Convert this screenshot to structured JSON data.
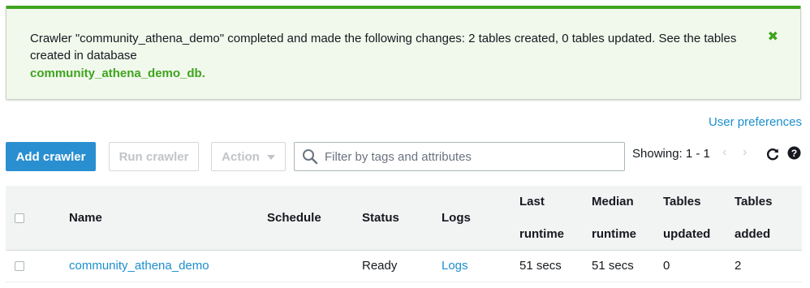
{
  "flash": {
    "message": "Crawler \"community_athena_demo\" completed and made the following changes: 2 tables created, 0 tables updated. See the tables created in database",
    "database": "community_athena_demo_db."
  },
  "user_preferences": "User preferences",
  "toolbar": {
    "add_label": "Add crawler",
    "run_label": "Run crawler",
    "action_label": "Action",
    "search_placeholder": "Filter by tags and attributes",
    "showing": "Showing: 1 - 1",
    "prev": "‹",
    "next": "›"
  },
  "table": {
    "headers": {
      "name": "Name",
      "schedule": "Schedule",
      "status": "Status",
      "logs": "Logs",
      "last_runtime_1": "Last",
      "last_runtime_2": "runtime",
      "median_runtime_1": "Median",
      "median_runtime_2": "runtime",
      "tables_updated_1": "Tables",
      "tables_updated_2": "updated",
      "tables_added_1": "Tables",
      "tables_added_2": "added"
    },
    "rows": [
      {
        "name": "community_athena_demo",
        "schedule": "",
        "status": "Ready",
        "logs": "Logs",
        "last_runtime": "51 secs",
        "median_runtime": "51 secs",
        "tables_updated": "0",
        "tables_added": "2"
      }
    ]
  },
  "colors": {
    "success": "#3ea41e",
    "primary": "#2a8fd1",
    "link": "#1a8fce"
  },
  "icons": [
    "close-icon",
    "search-icon",
    "refresh-icon",
    "help-icon"
  ]
}
